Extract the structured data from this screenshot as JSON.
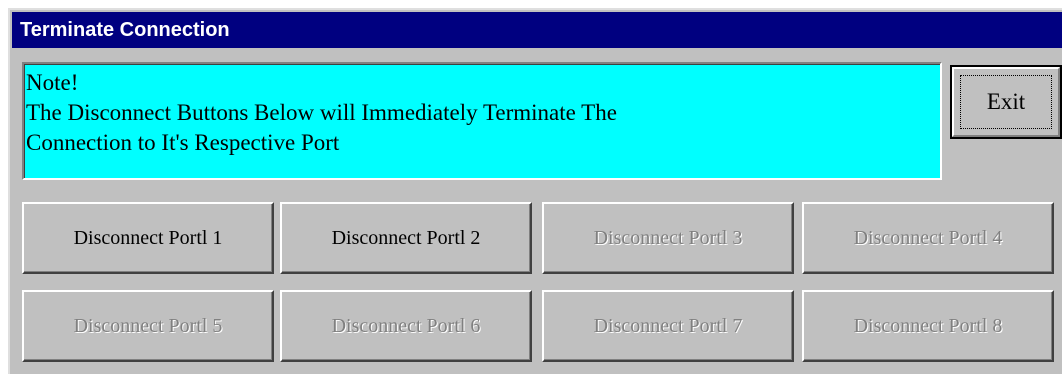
{
  "window": {
    "title": "Terminate Connection"
  },
  "note": {
    "lines": [
      "Note!",
      "The Disconnect Buttons Below will Immediately Terminate The",
      "Connection to It's Respective Port"
    ],
    "background_color": "#00ffff"
  },
  "exit_button": {
    "label": "Exit"
  },
  "ports": [
    {
      "label": "Disconnect Portl  1",
      "enabled": true
    },
    {
      "label": "Disconnect Portl  2",
      "enabled": true
    },
    {
      "label": "Disconnect Portl  3",
      "enabled": false
    },
    {
      "label": "Disconnect Portl  4",
      "enabled": false
    },
    {
      "label": "Disconnect Portl  5",
      "enabled": false
    },
    {
      "label": "Disconnect Portl  6",
      "enabled": false
    },
    {
      "label": "Disconnect Portl  7",
      "enabled": false
    },
    {
      "label": "Disconnect Portl  8",
      "enabled": false
    }
  ],
  "colors": {
    "titlebar": "#000080",
    "face": "#c0c0c0",
    "disabled_text": "#808080"
  }
}
